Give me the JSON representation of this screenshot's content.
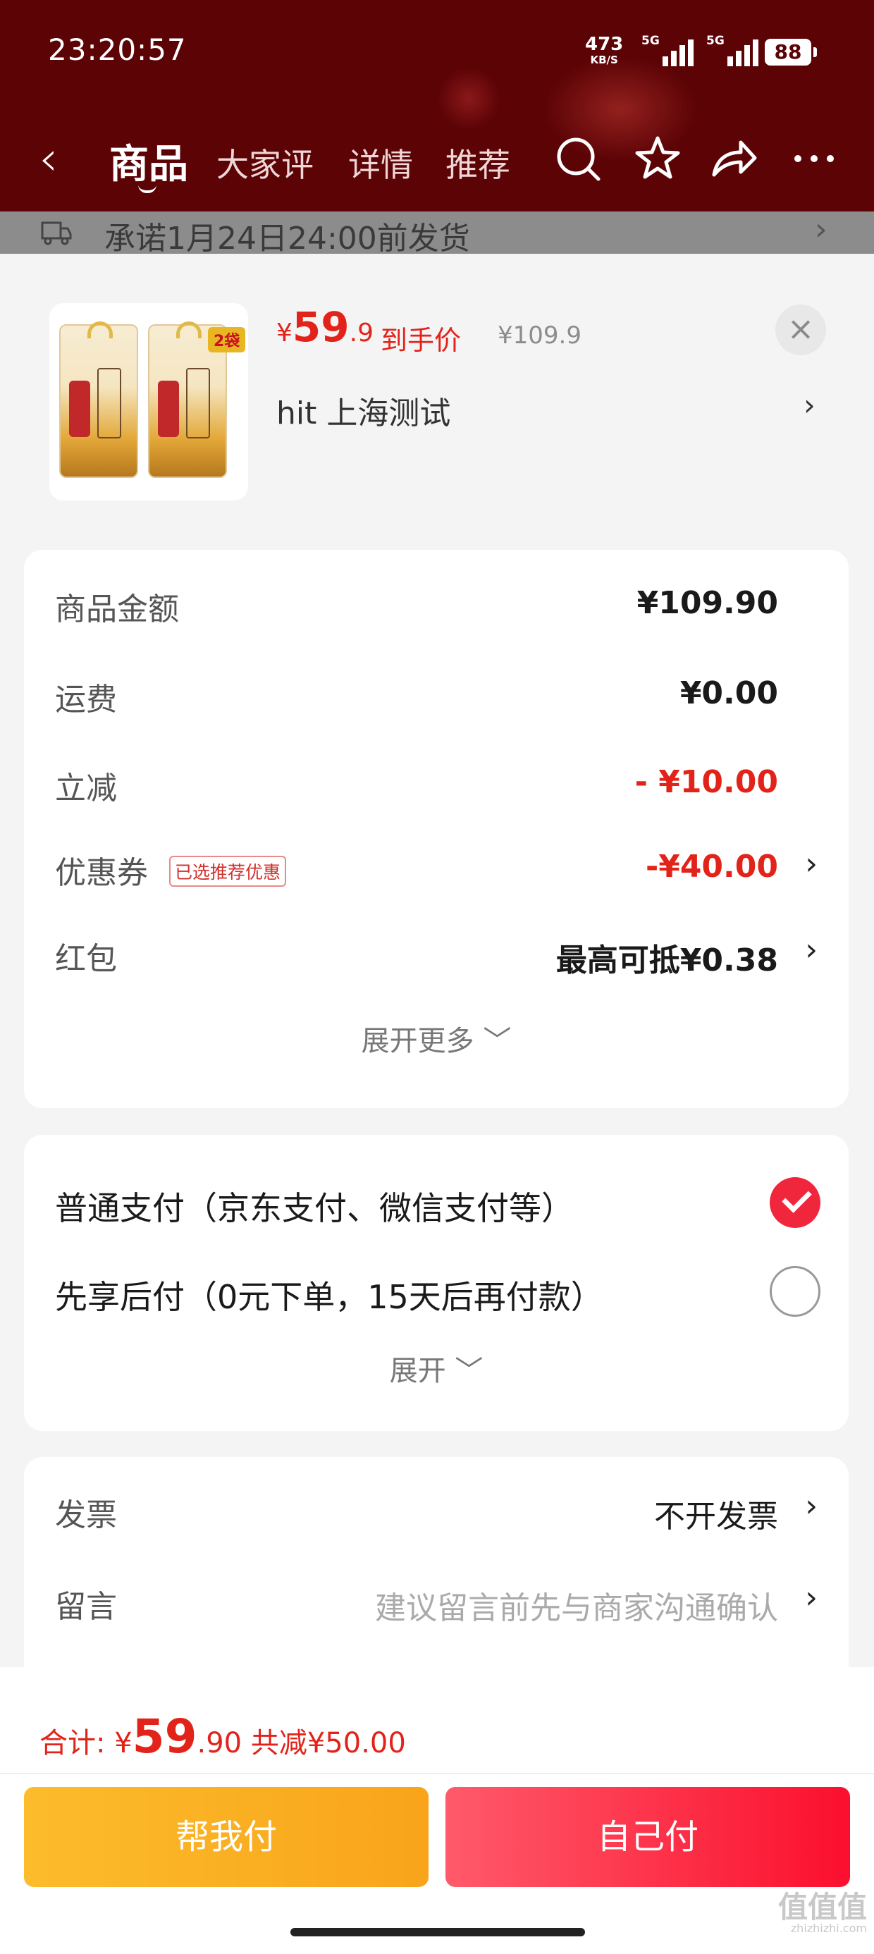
{
  "status_bar": {
    "time": "23:20:57",
    "net_speed": "473",
    "net_unit": "KB/S",
    "signal_1_label": "5G",
    "signal_2_label": "5G",
    "battery": "88"
  },
  "nav": {
    "tabs": [
      "商品",
      "大家评",
      "详情",
      "推荐"
    ],
    "active_tab": "商品"
  },
  "delivery_banner": "承诺1月24日24:00前发货",
  "product": {
    "badge": "2袋",
    "price_symbol": "¥",
    "price_int": "59",
    "price_dec": ".9",
    "price_label": "到手价",
    "original_price": "¥109.9",
    "address": "hit  上海测试"
  },
  "amounts": {
    "goods_label": "商品金额",
    "goods_value": "¥109.90",
    "shipping_label": "运费",
    "shipping_value": "¥0.00",
    "discount_label": "立减",
    "discount_value": "- ¥10.00",
    "coupon_label": "优惠券",
    "coupon_tag": "已选推荐优惠",
    "coupon_value": "-¥40.00",
    "redpacket_label": "红包",
    "redpacket_value": "最高可抵¥0.38",
    "expand_more": "展开更多"
  },
  "payment": {
    "option_1": "普通支付（京东支付、微信支付等）",
    "option_2": "先享后付（0元下单，15天后再付款）",
    "selected": 1,
    "expand": "展开"
  },
  "extras": {
    "invoice_label": "发票",
    "invoice_value": "不开发票",
    "message_label": "留言",
    "message_placeholder": "建议留言前先与商家沟通确认"
  },
  "summary": {
    "total_label": "合计:",
    "total_symbol": "¥",
    "total_int": "59",
    "total_dec": ".90",
    "saved": "共减¥50.00"
  },
  "buttons": {
    "help_pay": "帮我付",
    "self_pay": "自己付"
  },
  "watermark": {
    "main": "值值值",
    "sub": "zhizhizhi.com"
  },
  "colors": {
    "header_bg": "#5c0306",
    "price_red": "#e2231a",
    "help_btn": "#fbb224",
    "self_btn": "#fc2a40"
  }
}
